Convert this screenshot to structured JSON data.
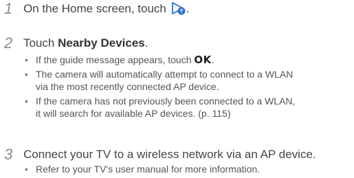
{
  "steps": [
    {
      "number": "1",
      "text_before": "On the Home screen, touch",
      "icon": "smart-link-app-icon",
      "text_after": "."
    },
    {
      "number": "2",
      "text_before": "Touch ",
      "bold": "Nearby Devices",
      "text_after": ".",
      "bullets": [
        {
          "before": "If the guide message appears, touch ",
          "key": "OK",
          "after": "."
        },
        {
          "line1": "The camera will automatically attempt to connect to a WLAN",
          "line2": "via the most recently connected AP device."
        },
        {
          "line1": "If the camera has not previously been connected to a WLAN,",
          "line2": "it will search for available AP devices. (p. 115)"
        }
      ]
    },
    {
      "number": "3",
      "text": "Connect your TV to a wireless network via an AP device.",
      "bullets": [
        {
          "line1": "Refer to your TV's user manual for more information."
        }
      ]
    }
  ],
  "colors": {
    "text": "#444444",
    "step_number": "#8a8a8a",
    "icon_blue": "#3a7fd5"
  }
}
